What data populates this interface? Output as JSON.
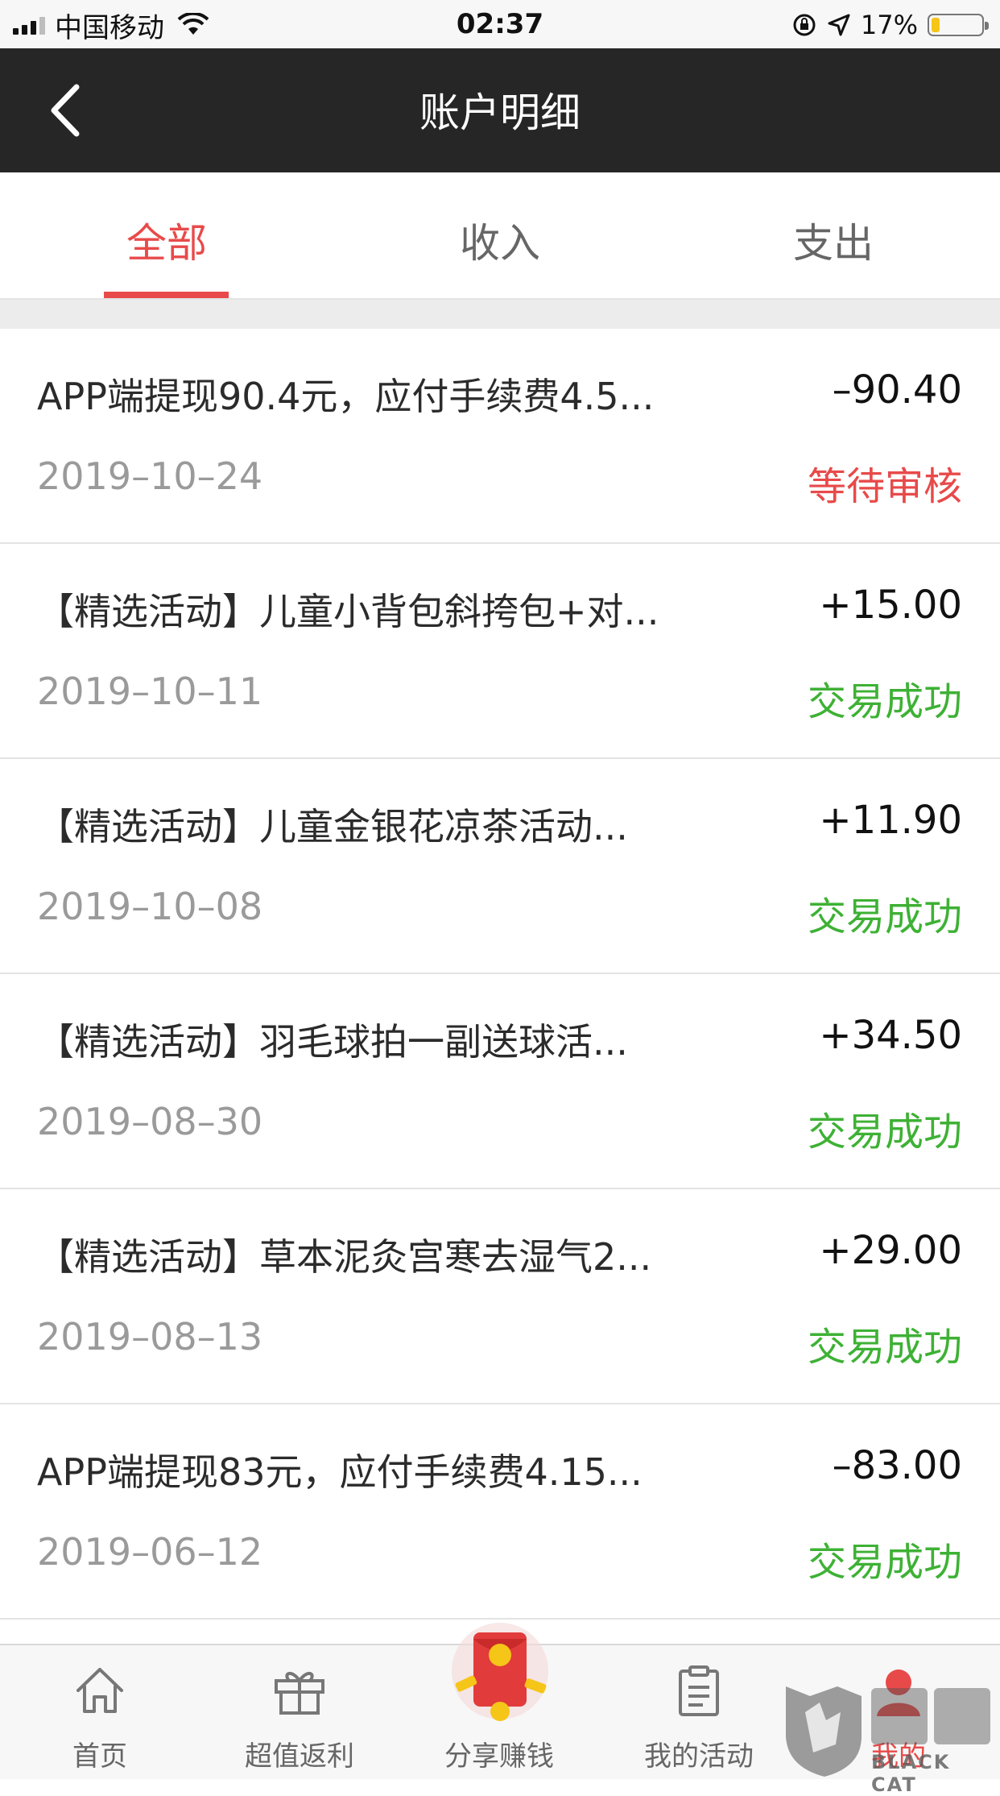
{
  "status_bar": {
    "carrier": "中国移动",
    "time": "02:37",
    "battery": "17%",
    "battery_level": 0.17
  },
  "nav": {
    "title": "账户明细",
    "back_icon": "chevron-left-icon"
  },
  "tabs": [
    {
      "label": "全部",
      "active": true
    },
    {
      "label": "收入",
      "active": false
    },
    {
      "label": "支出",
      "active": false
    }
  ],
  "records": [
    {
      "desc": "APP端提现90.4元，应付手续费4.5...",
      "amount": "–90.40",
      "date": "2019–10–24",
      "status": "等待审核",
      "status_color": "#e84a4a"
    },
    {
      "desc": "【精选活动】儿童小背包斜挎包+对...",
      "amount": "+15.00",
      "date": "2019–10–11",
      "status": "交易成功",
      "status_color": "#3eb135"
    },
    {
      "desc": "【精选活动】儿童金银花凉茶活动...",
      "amount": "+11.90",
      "date": "2019–10–08",
      "status": "交易成功",
      "status_color": "#3eb135"
    },
    {
      "desc": "【精选活动】羽毛球拍一副送球活...",
      "amount": "+34.50",
      "date": "2019–08–30",
      "status": "交易成功",
      "status_color": "#3eb135"
    },
    {
      "desc": "【精选活动】草本泥灸宫寒去湿气2...",
      "amount": "+29.00",
      "date": "2019–08–13",
      "status": "交易成功",
      "status_color": "#3eb135"
    },
    {
      "desc": "APP端提现83元，应付手续费4.15...",
      "amount": "–83.00",
      "date": "2019–06–12",
      "status": "交易成功",
      "status_color": "#3eb135"
    }
  ],
  "tab_bar": [
    {
      "label": "首页",
      "icon": "home-icon"
    },
    {
      "label": "超值返利",
      "icon": "gift-icon"
    },
    {
      "label": "分享赚钱",
      "icon": "red-envelope-icon"
    },
    {
      "label": "我的活动",
      "icon": "clipboard-icon"
    },
    {
      "label": "我的",
      "icon": "profile-icon",
      "active": true
    }
  ],
  "watermark": {
    "text": "BLACK CAT",
    "logo": "black-cat-logo"
  },
  "colors": {
    "accent": "#e84a4a",
    "success": "#3eb135",
    "nav_bg": "#262626"
  }
}
